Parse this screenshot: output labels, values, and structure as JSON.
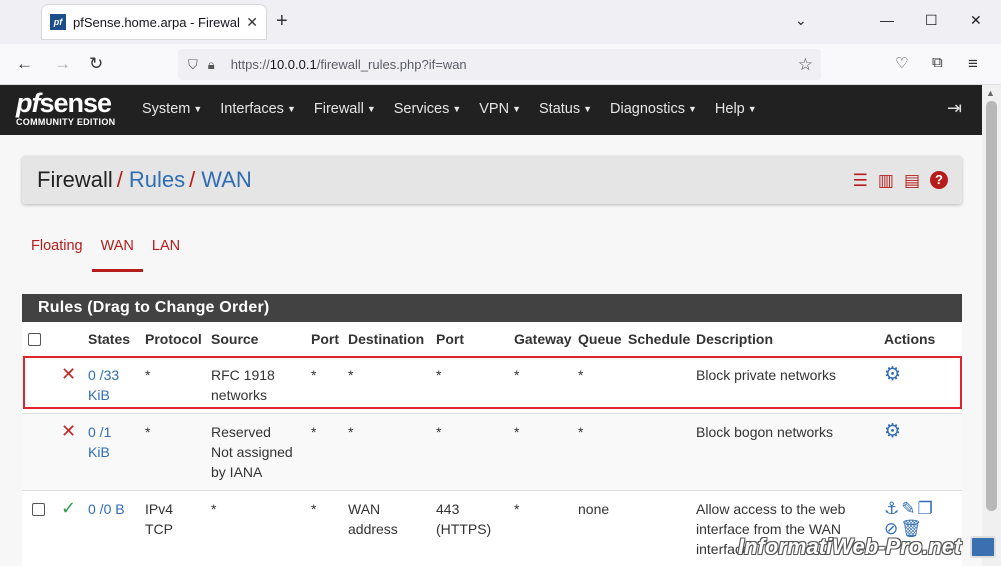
{
  "browser": {
    "tab_title": "pfSense.home.arpa - Firewall: R",
    "favicon": "pf",
    "url_prefix": "https://",
    "url_host": "10.0.0.1",
    "url_path": "/firewall_rules.php?if=wan"
  },
  "header": {
    "logo_pf": "pf",
    "logo_sense": "sense",
    "logo_sub": "COMMUNITY EDITION",
    "menu": [
      "System",
      "Interfaces",
      "Firewall",
      "Services",
      "VPN",
      "Status",
      "Diagnostics",
      "Help"
    ]
  },
  "breadcrumb": {
    "part1": "Firewall",
    "part2": "Rules",
    "part3": "WAN"
  },
  "tabs": [
    "Floating",
    "WAN",
    "LAN"
  ],
  "active_tab": "WAN",
  "panel_title": "Rules (Drag to Change Order)",
  "columns": [
    "States",
    "Protocol",
    "Source",
    "Port",
    "Destination",
    "Port",
    "Gateway",
    "Queue",
    "Schedule",
    "Description",
    "Actions"
  ],
  "rows": [
    {
      "states1": "0 /33",
      "states2": "KiB",
      "protocol1": "*",
      "protocol2": "",
      "source1": "RFC 1918",
      "source2": "networks",
      "source3": "",
      "port": "*",
      "destination1": "*",
      "destination2": "",
      "dport1": "*",
      "dport2": "",
      "gateway": "*",
      "queue": "*",
      "schedule": "",
      "description1": "Block private networks",
      "description2": "",
      "description3": ""
    },
    {
      "states1": "0 /1",
      "states2": "KiB",
      "protocol1": "*",
      "protocol2": "",
      "source1": "Reserved",
      "source2": "Not assigned",
      "source3": "by IANA",
      "port": "*",
      "destination1": "*",
      "destination2": "",
      "dport1": "*",
      "dport2": "",
      "gateway": "*",
      "queue": "*",
      "schedule": "",
      "description1": "Block bogon networks",
      "description2": "",
      "description3": ""
    },
    {
      "states1": "0 /0 B",
      "states2": "",
      "protocol1": "IPv4",
      "protocol2": "TCP",
      "source1": "*",
      "source2": "",
      "source3": "",
      "port": "*",
      "destination1": "WAN",
      "destination2": "address",
      "dport1": "443",
      "dport2": "(HTTPS)",
      "gateway": "*",
      "queue": "none",
      "schedule": "",
      "description1": "Allow access to the web",
      "description2": "interface from the WAN",
      "description3": "interface"
    }
  ],
  "watermark": "InformatiWeb-Pro.net"
}
